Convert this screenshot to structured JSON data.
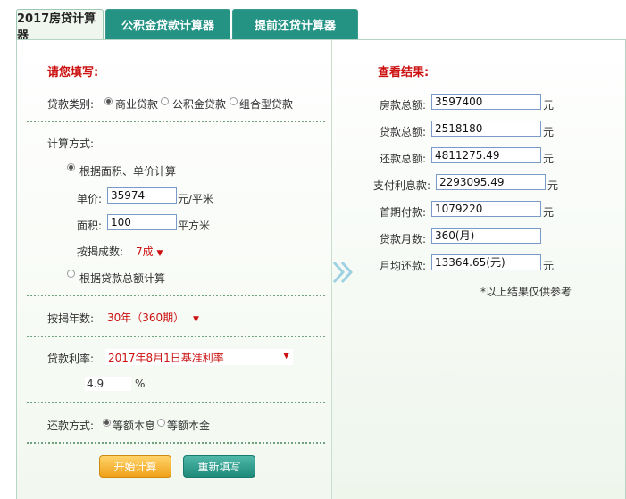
{
  "tabs": [
    {
      "label": "2017房贷计算器"
    },
    {
      "label": "公积金贷款计算器"
    },
    {
      "label": "提前还贷计算器"
    }
  ],
  "form": {
    "title": "请您填写:",
    "loan_type_label": "贷款类别:",
    "loan_type_options": [
      "商业贷款",
      "公积金贷款",
      "组合型贷款"
    ],
    "loan_type_selected": "商业贷款",
    "calc_method_label": "计算方式:",
    "method_area_label": "根据面积、单价计算",
    "unit_price_label": "单价:",
    "unit_price_value": "35974",
    "unit_price_unit": "元/平米",
    "area_label": "面积:",
    "area_value": "100",
    "area_unit": "平方米",
    "ratio_label": "按揭成数:",
    "ratio_value": "7成",
    "method_total_label": "根据贷款总额计算",
    "years_label": "按揭年数:",
    "years_value": "30年（360期）",
    "rate_label": "贷款利率:",
    "rate_value": "2017年8月1日基准利率",
    "rate_number": "4.9",
    "rate_unit": "%",
    "repay_label": "还款方式:",
    "repay_options": [
      "等额本息",
      "等额本金"
    ],
    "repay_selected": "等额本息",
    "start_button": "开始计算",
    "reset_button": "重新填写"
  },
  "results": {
    "title": "查看结果:",
    "rows": [
      {
        "label": "房款总额:",
        "value": "3597400",
        "unit": "元"
      },
      {
        "label": "贷款总额:",
        "value": "2518180",
        "unit": "元"
      },
      {
        "label": "还款总额:",
        "value": "4811275.49",
        "unit": "元"
      },
      {
        "label": "支付利息款:",
        "value": "2293095.49",
        "unit": "元"
      },
      {
        "label": "首期付款:",
        "value": "1079220",
        "unit": "元"
      },
      {
        "label": "贷款月数:",
        "value": "360(月)",
        "unit": ""
      },
      {
        "label": "月均还款:",
        "value": "13364.65(元)",
        "unit": "元"
      }
    ],
    "note": "*以上结果仅供参考"
  },
  "colors": {
    "accent_teal": "#249384",
    "label_red": "#cc1111",
    "button_orange": "#f0a21a"
  }
}
